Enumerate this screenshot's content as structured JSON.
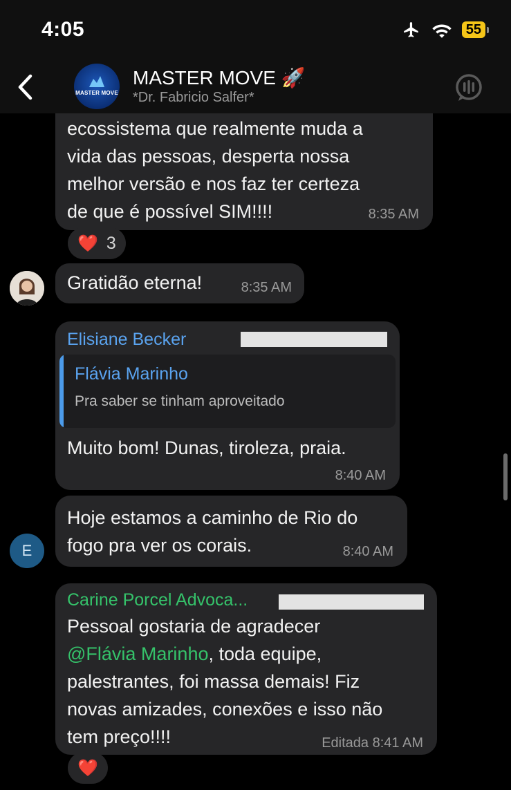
{
  "status_bar": {
    "time": "4:05",
    "battery_level": "55"
  },
  "header": {
    "title": "MASTER MOVE",
    "title_emoji": "🚀",
    "subtitle": "*Dr. Fabricio Salfer*",
    "avatar_text": "MASTER MOVE"
  },
  "messages": [
    {
      "lines": [
        "ecossistema que realmente muda a",
        "vida das pessoas, desperta nossa",
        "melhor versão e nos faz ter certeza",
        "de que é possível SIM!!!!"
      ],
      "time": "8:35 AM",
      "reaction": {
        "emoji": "❤️",
        "count": "3"
      }
    },
    {
      "text": "Gratidão eterna!",
      "time": "8:35 AM"
    },
    {
      "sender": "Elisiane Becker",
      "sender_color": "#5aa3ef",
      "reply": {
        "sender": "Flávia Marinho",
        "text": "Pra saber se tinham aproveitado"
      },
      "text": "Muito bom! Dunas, tiroleza,  praia.",
      "time": "8:40 AM"
    },
    {
      "lines": [
        "Hoje estamos a caminho de Rio do",
        "fogo pra ver os corais."
      ],
      "time": "8:40 AM",
      "avatar_letter": "E"
    },
    {
      "sender": "Carine Porcel Advoca...",
      "sender_color": "#35c26a",
      "line1": "Pessoal gostaria de agradecer",
      "mention": "@Flávia Marinho",
      "line2_rest": ", toda equipe,",
      "line3": "palestrantes, foi massa demais! Fiz",
      "line4": "novas amizades, conexões e isso não",
      "line5": "tem preço!!!!",
      "edited_label": "Editada",
      "time": "8:41 AM",
      "reaction": {
        "emoji": "❤️"
      }
    }
  ]
}
